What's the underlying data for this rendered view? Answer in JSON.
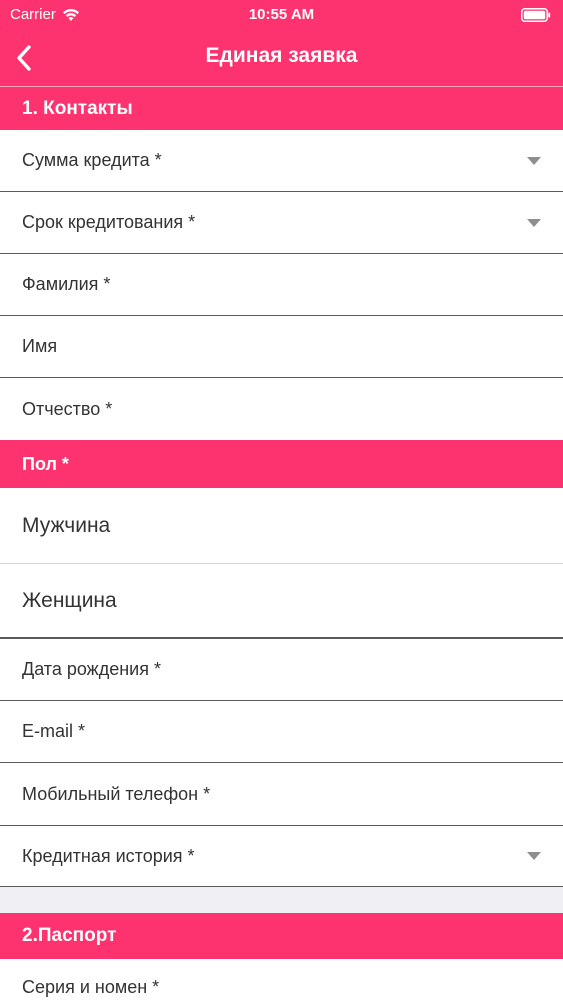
{
  "status_bar": {
    "carrier": "Carrier",
    "time": "10:55 AM"
  },
  "nav": {
    "title": "Единая заявка",
    "back_icon": "chevron-left-icon"
  },
  "colors": {
    "accent": "#FC336E",
    "divider": "#5a5a5a",
    "text": "#333333"
  },
  "section_contacts": {
    "title": "1. Контакты",
    "fields": [
      {
        "label": "Сумма кредита *",
        "dropdown": true
      },
      {
        "label": "Срок кредитования *",
        "dropdown": true
      },
      {
        "label": "Фамилия *",
        "dropdown": false
      },
      {
        "label": "Имя",
        "dropdown": false
      },
      {
        "label": "Отчество *",
        "dropdown": false
      }
    ]
  },
  "gender": {
    "title": "Пол *",
    "options": [
      "Мужчина",
      "Женщина"
    ]
  },
  "contacts_more": {
    "fields": [
      {
        "label": "Дата рождения *",
        "dropdown": false
      },
      {
        "label": "E-mail *",
        "dropdown": false
      },
      {
        "label": "Мобильный телефон *",
        "dropdown": false
      },
      {
        "label": "Кредитная история *",
        "dropdown": true
      }
    ]
  },
  "section_passport": {
    "title": "2.Паспорт",
    "fields": [
      {
        "label": "Серия и номен *",
        "dropdown": false
      }
    ]
  }
}
